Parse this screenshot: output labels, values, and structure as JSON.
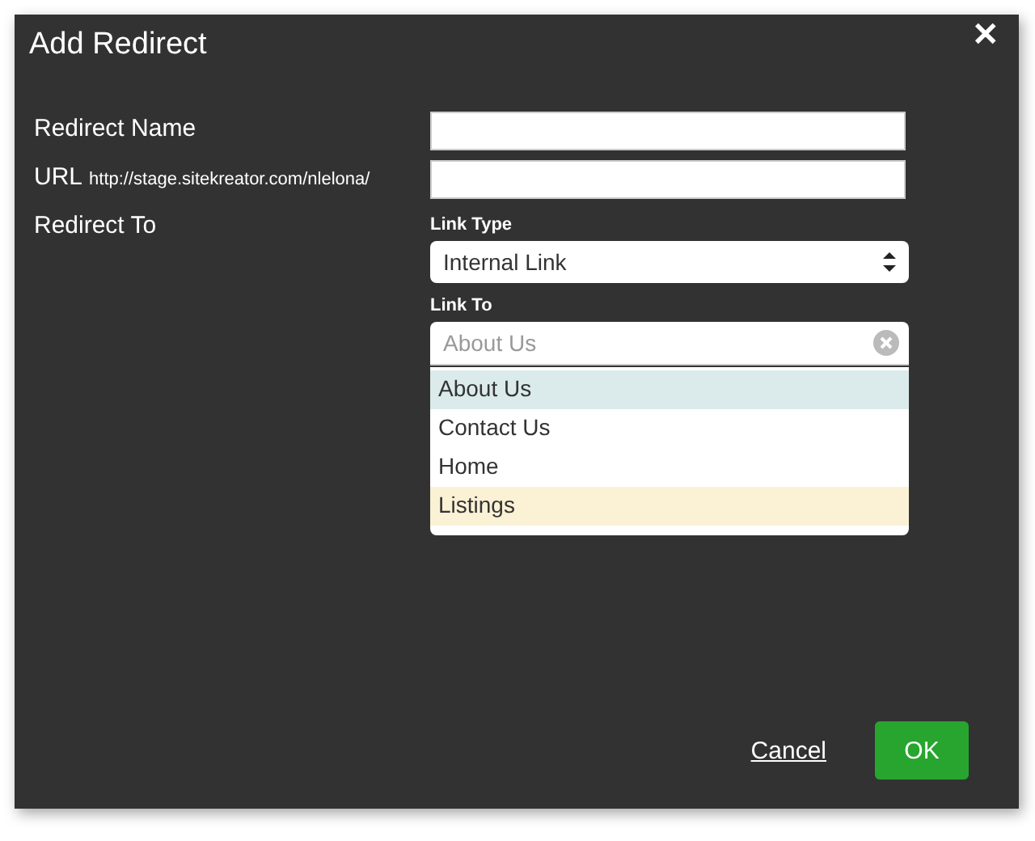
{
  "dialog": {
    "title": "Add Redirect",
    "close": "✕"
  },
  "fields": [
    {
      "kind": "text",
      "label": "Redirect Name"
    },
    {
      "kind": "url",
      "label": "URL",
      "prefix": "http://stage.sitekreator.com/nlelona/"
    },
    {
      "kind": "redirect",
      "label": "Redirect To",
      "link_type": {
        "label": "Link Type",
        "value": "Internal Link"
      },
      "link_to": {
        "label": "Link To",
        "placeholder": "About Us",
        "options": [
          {
            "label": "About Us",
            "selected": true,
            "hovered": false
          },
          {
            "label": "Contact Us",
            "selected": false,
            "hovered": false
          },
          {
            "label": "Home",
            "selected": false,
            "hovered": false
          },
          {
            "label": "Listings",
            "selected": false,
            "hovered": true
          }
        ]
      }
    }
  ],
  "buttons": [
    {
      "kind": "link",
      "label": "Cancel"
    },
    {
      "kind": "primary",
      "label": "OK"
    }
  ]
}
